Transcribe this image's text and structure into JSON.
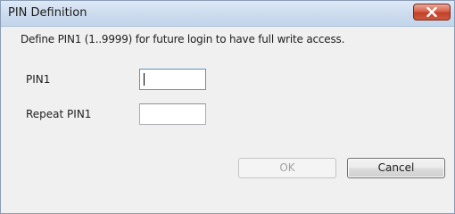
{
  "window": {
    "title": "PIN Definition",
    "close_icon": "close-x-icon"
  },
  "dialog": {
    "instruction": "Define PIN1 (1..9999) for future login to have full write access.",
    "fields": [
      {
        "label": "PIN1",
        "value": "",
        "focused": true
      },
      {
        "label": "Repeat PIN1",
        "value": "",
        "focused": false
      }
    ]
  },
  "buttons": {
    "ok": {
      "label": "OK",
      "enabled": false
    },
    "cancel": {
      "label": "Cancel",
      "enabled": true
    }
  },
  "colors": {
    "close_button": "#c7432b",
    "titlebar": "#cddcee",
    "dialog_background": "#f0f0f0"
  }
}
